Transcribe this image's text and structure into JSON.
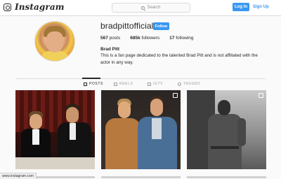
{
  "header": {
    "logo_text": "Instagram",
    "search_placeholder": "Search",
    "login_label": "Log In",
    "signup_label": "Sign Up"
  },
  "profile": {
    "username": "bradpittofficial",
    "follow_label": "Follow",
    "stats": {
      "posts_count": "567",
      "posts_label": "posts",
      "followers_count": "685k",
      "followers_label": "followers",
      "following_count": "17",
      "following_label": "following"
    },
    "full_name": "Brad Pitt",
    "bio": "This is a fan page dedicated to the talented Brad Pitt and is not affiliated with the actor in any way."
  },
  "tabs": [
    {
      "label": "POSTS",
      "active": true,
      "icon": "grid-icon"
    },
    {
      "label": "REELS",
      "active": false,
      "icon": "reels-icon"
    },
    {
      "label": "IGTV",
      "active": false,
      "icon": "igtv-icon"
    },
    {
      "label": "TAGGED",
      "active": false,
      "icon": "tagged-icon"
    }
  ],
  "status_bar": {
    "url": "www.instagram.com"
  },
  "colors": {
    "accent": "#3897f0",
    "background": "#fafafa",
    "text": "#262626"
  }
}
